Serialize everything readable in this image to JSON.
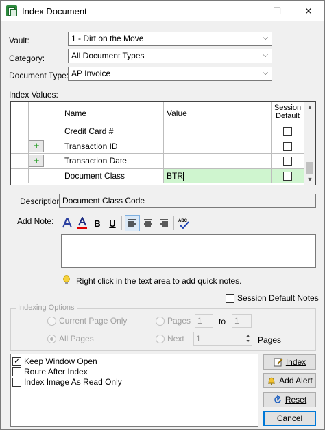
{
  "window": {
    "title": "Index Document",
    "controls": [
      "—",
      "☐",
      "✕"
    ]
  },
  "form": {
    "vault_label": "Vault:",
    "vault_value": "1 - Dirt on the Move",
    "category_label": "Category:",
    "category_value": "All Document Types",
    "doctype_label": "Document Type:",
    "doctype_value": "AP Invoice",
    "index_values_label": "Index Values:"
  },
  "grid": {
    "headers": {
      "name": "Name",
      "value": "Value",
      "session": "Session Default"
    },
    "rows": [
      {
        "name": "Credit Card #",
        "value": "",
        "has_add": false,
        "session_default": false,
        "highlight": false
      },
      {
        "name": "Transaction ID",
        "value": "",
        "has_add": true,
        "session_default": false,
        "highlight": false
      },
      {
        "name": "Transaction Date",
        "value": "",
        "has_add": true,
        "session_default": false,
        "highlight": false
      },
      {
        "name": "Document Class",
        "value": "BTR",
        "has_add": false,
        "session_default": false,
        "highlight": true
      }
    ],
    "highlight_color": "#cff5cf"
  },
  "description": {
    "label": "Description:",
    "value": "Document Class Code"
  },
  "note": {
    "label": "Add Note:",
    "hint": "Right click in the text area to add quick notes.",
    "session_default_notes": "Session Default Notes",
    "toolbar": [
      "font-icon",
      "font-color-icon",
      "B",
      "U",
      "align-left-icon",
      "align-center-icon",
      "align-right-icon",
      "spellcheck-icon"
    ]
  },
  "indexing_options": {
    "legend": "Indexing Options",
    "current_page_only": "Current Page Only",
    "all_pages": "All Pages",
    "pages_label": "Pages",
    "pages_from": "1",
    "to_label": "to",
    "pages_to": "1",
    "next_label": "Next",
    "next_value": "1",
    "pages_suffix": "Pages"
  },
  "options": [
    {
      "label": "Keep Window Open",
      "checked": true
    },
    {
      "label": "Route After Index",
      "checked": false
    },
    {
      "label": "Index Image As Read Only",
      "checked": false
    }
  ],
  "buttons": {
    "index": "Index",
    "add_alert": "Add Alert",
    "reset": "Reset",
    "cancel": "Cancel"
  }
}
